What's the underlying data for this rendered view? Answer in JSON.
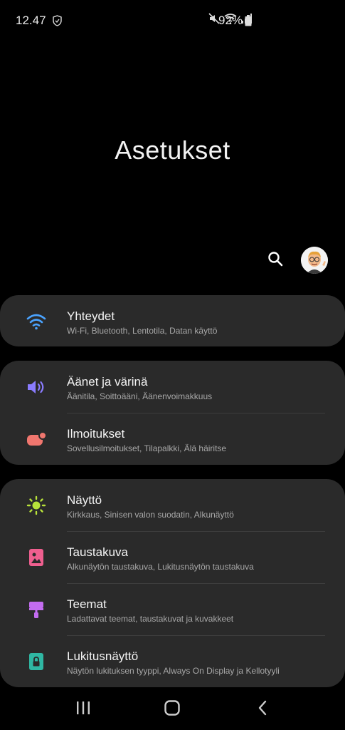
{
  "status_bar": {
    "time": "12.47",
    "battery_percent": "92%",
    "icons": [
      "shield-icon",
      "mute-icon",
      "wifi-icon",
      "signal-icon",
      "battery-icon"
    ]
  },
  "page": {
    "title": "Asetukset"
  },
  "header": {
    "icons": [
      "search-icon",
      "avatar"
    ]
  },
  "groups": [
    {
      "items": [
        {
          "title": "Yhteydet",
          "subtitle": "Wi-Fi, Bluetooth, Lentotila, Datan käyttö",
          "icon": "wifi-icon",
          "color": "#4aa3ff"
        }
      ]
    },
    {
      "items": [
        {
          "title": "Äänet ja värinä",
          "subtitle": "Äänitila, Soittoääni, Äänenvoimakkuus",
          "icon": "volume-icon",
          "color": "#8a7cff"
        },
        {
          "title": "Ilmoitukset",
          "subtitle": "Sovellusilmoitukset, Tilapalkki, Älä häiritse",
          "icon": "notification-icon",
          "color": "#f0766e"
        }
      ]
    },
    {
      "items": [
        {
          "title": "Näyttö",
          "subtitle": "Kirkkaus, Sinisen valon suodatin, Alkunäyttö",
          "icon": "brightness-icon",
          "color": "#b8e23a"
        },
        {
          "title": "Taustakuva",
          "subtitle": "Alkunäytön taustakuva, Lukitusnäytön taustakuva",
          "icon": "wallpaper-icon",
          "color": "#ef5f8f"
        },
        {
          "title": "Teemat",
          "subtitle": "Ladattavat teemat, taustakuvat ja kuvakkeet",
          "icon": "themes-icon",
          "color": "#c36cf0"
        },
        {
          "title": "Lukitusnäyttö",
          "subtitle": "Näytön lukituksen tyyppi, Always On Display ja Kellotyyli",
          "icon": "lock-icon",
          "color": "#2fb7a3"
        }
      ]
    }
  ],
  "nav_bar": {
    "icons": [
      "recents-icon",
      "home-icon",
      "back-icon"
    ]
  }
}
